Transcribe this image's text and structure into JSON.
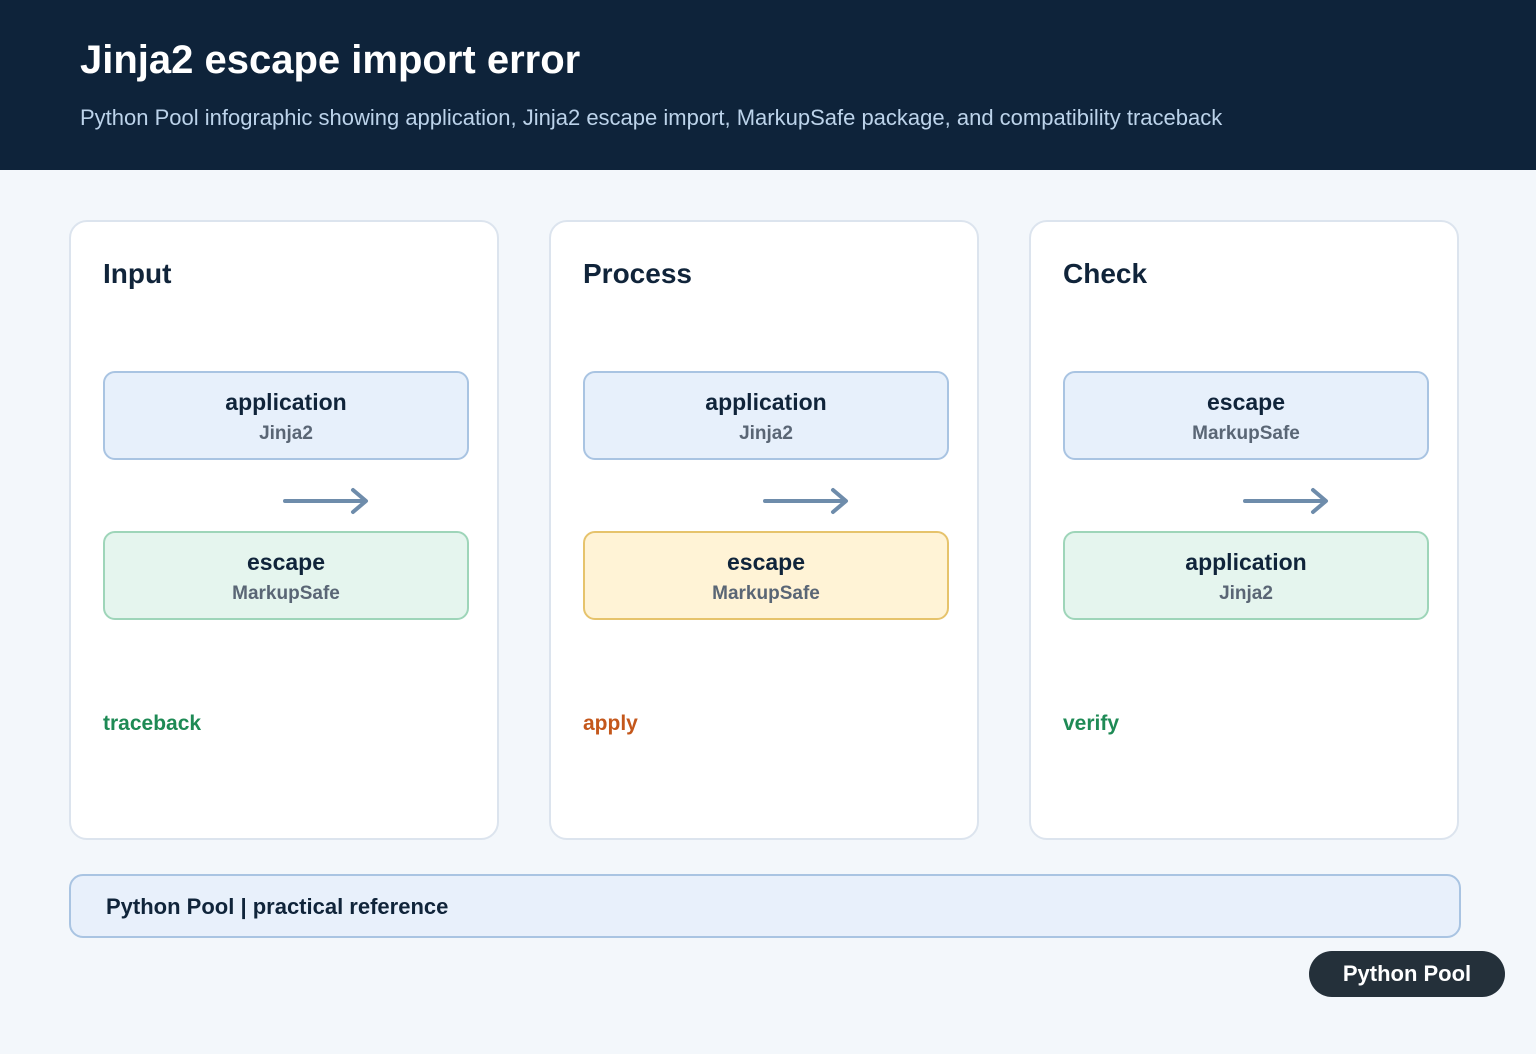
{
  "header": {
    "title": "Jinja2 escape import error",
    "subtitle": "Python Pool infographic showing application, Jinja2 escape import, MarkupSafe package, and compatibility traceback"
  },
  "panels": [
    {
      "title": "Input",
      "top_node": {
        "label": "application",
        "sub": "Jinja2"
      },
      "bottom_node": {
        "label": "escape",
        "sub": "MarkupSafe"
      },
      "note": "traceback"
    },
    {
      "title": "Process",
      "top_node": {
        "label": "application",
        "sub": "Jinja2"
      },
      "bottom_node": {
        "label": "escape",
        "sub": "MarkupSafe"
      },
      "note": "apply"
    },
    {
      "title": "Check",
      "top_node": {
        "label": "escape",
        "sub": "MarkupSafe"
      },
      "bottom_node": {
        "label": "application",
        "sub": "Jinja2"
      },
      "note": "verify"
    }
  ],
  "footer": {
    "text": "Python Pool | practical reference"
  },
  "brand": {
    "label": "Python Pool"
  },
  "colors": {
    "header_bg": "#0e233a",
    "note_green": "#1e8a55",
    "note_orange": "#c4571b",
    "arrow": "#6e8cab"
  }
}
